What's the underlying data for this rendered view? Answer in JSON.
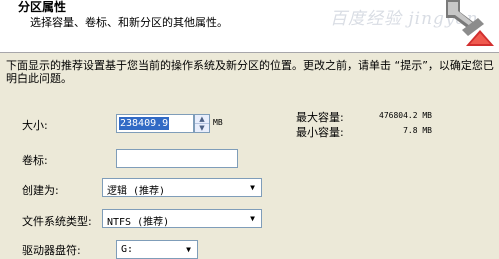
{
  "header": {
    "title": "分区属性",
    "subtitle": "选择容量、卷标、和新分区的其他属性。",
    "watermark": "百度经验 jingyan"
  },
  "intro": "下面显示的推荐设置基于您当前的操作系统及新分区的位置。更改之前，请单击 “提示”，以确定您已明白此问题。",
  "size": {
    "label": "大小:",
    "value": "238409.9",
    "unit": "MB",
    "spin_up": "▲",
    "spin_down": "▼"
  },
  "capacity": {
    "max_label": "最大容量:",
    "max_value": "476804.2 MB",
    "min_label": "最小容量:",
    "min_value": "7.8 MB"
  },
  "volume_label": {
    "label": "卷标:",
    "value": ""
  },
  "create_as": {
    "label": "创建为:",
    "value": "逻辑 (推荐)",
    "arrow": "▼"
  },
  "filesystem": {
    "label": "文件系统类型:",
    "value": "NTFS (推荐)",
    "arrow": "▼"
  },
  "drive_letter": {
    "label": "驱动器盘符:",
    "value": "G:",
    "arrow": "▼"
  },
  "colors": {
    "selection": "#316ac5",
    "field_border": "#7f9db9",
    "dialog_bg": "#ece9d8"
  },
  "icons": {
    "wizard": "partition-wizard-icon"
  }
}
